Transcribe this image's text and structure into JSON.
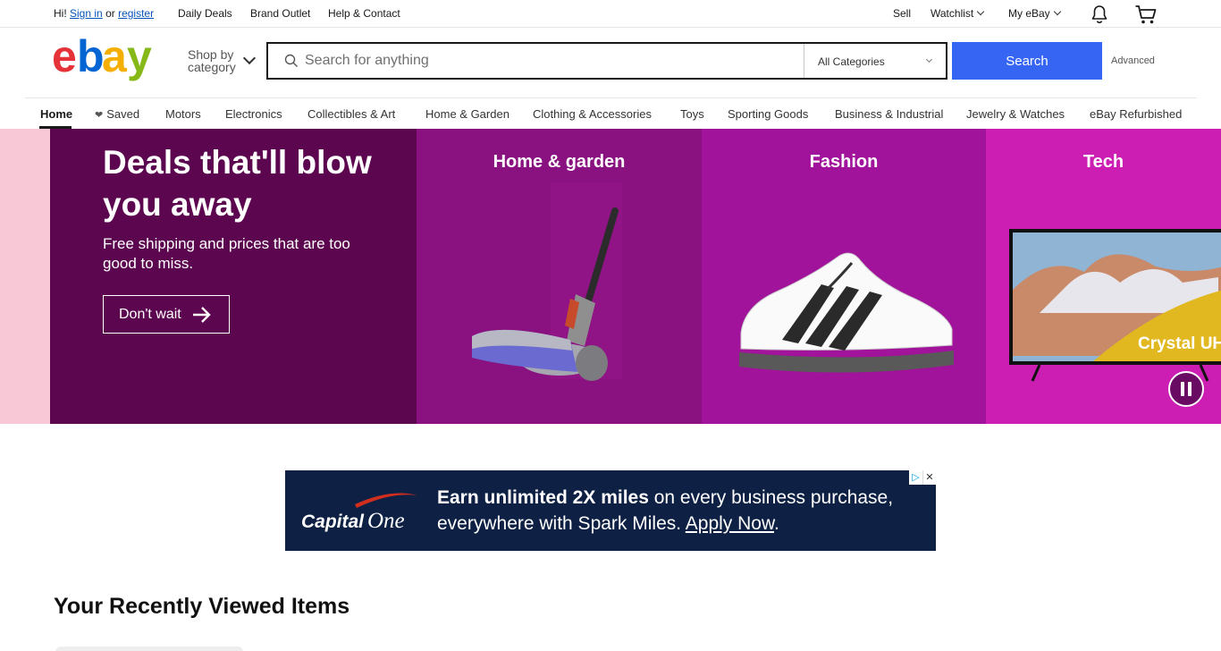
{
  "topbar": {
    "greeting": "Hi!",
    "sign_in": "Sign in",
    "or": "or",
    "register": "register",
    "daily_deals": "Daily Deals",
    "brand_outlet": "Brand Outlet",
    "help_contact": "Help & Contact",
    "sell": "Sell",
    "watchlist": "Watchlist",
    "my_ebay": "My eBay"
  },
  "header": {
    "shop_by_line1": "Shop by",
    "shop_by_line2": "category",
    "search_placeholder": "Search for anything",
    "category_selected": "All Categories",
    "search_button": "Search",
    "advanced": "Advanced",
    "logo_colors": [
      "#e53238",
      "#0064d2",
      "#f5af02",
      "#86b817"
    ]
  },
  "nav": {
    "items": [
      {
        "label": "Home"
      },
      {
        "label": "Saved"
      },
      {
        "label": "Motors"
      },
      {
        "label": "Electronics"
      },
      {
        "label": "Collectibles & Art"
      },
      {
        "label": "Home & Garden"
      },
      {
        "label": "Clothing & Accessories"
      },
      {
        "label": "Toys"
      },
      {
        "label": "Sporting Goods"
      },
      {
        "label": "Business & Industrial"
      },
      {
        "label": "Jewelry & Watches"
      },
      {
        "label": "eBay Refurbished"
      }
    ]
  },
  "hero": {
    "title": "Deals that'll blow you away",
    "subtitle": "Free shipping and prices that are too good to miss.",
    "cta": "Don't wait",
    "panels": [
      {
        "title": "Home & garden"
      },
      {
        "title": "Fashion"
      },
      {
        "title": "Tech"
      }
    ],
    "tv_text": "Crystal UH"
  },
  "ad": {
    "brand": "CapitalOne",
    "headline_bold": "Earn unlimited 2X miles",
    "headline_rest": " on every business purchase, everywhere with Spark Miles. ",
    "apply": "Apply Now",
    "period": "."
  },
  "recent": {
    "title": "Your Recently Viewed Items"
  }
}
